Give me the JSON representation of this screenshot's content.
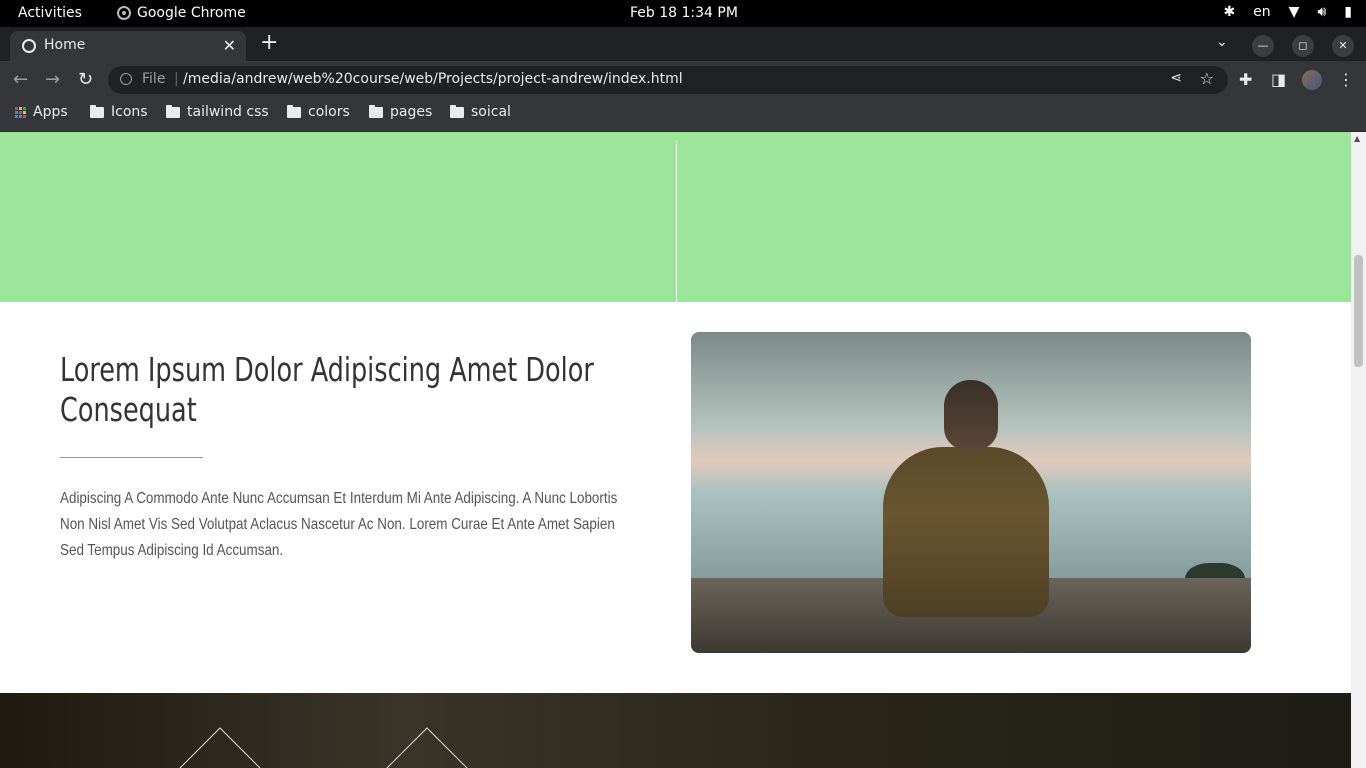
{
  "system_bar": {
    "activities": "Activities",
    "app_name": "Google Chrome",
    "datetime": "Feb 18  1:34 PM",
    "language": "en"
  },
  "browser": {
    "tab_title": "Home",
    "url": "/media/andrew/web%20course/web/Projects/project-andrew/index.html",
    "url_scheme_label": "File",
    "bookmarks": [
      "Apps",
      "Icons",
      "tailwind css",
      "colors",
      "pages",
      "soical"
    ]
  },
  "page": {
    "heading": "Lorem Ipsum Dolor Adipiscing Amet Dolor Consequat",
    "paragraph": "Adipiscing A Commodo Ante Nunc Accumsan Et Interdum Mi Ante Adipiscing. A Nunc Lobortis Non Nisl Amet Vis Sed Volutpat Aclacus Nascetur Ac Non. Lorem Curae Et Ante Amet Sapien Sed Tempus Adipiscing Id Accumsan."
  },
  "colors": {
    "green_band": "#9de59b",
    "heading_text": "#333333",
    "body_text": "#555555"
  }
}
